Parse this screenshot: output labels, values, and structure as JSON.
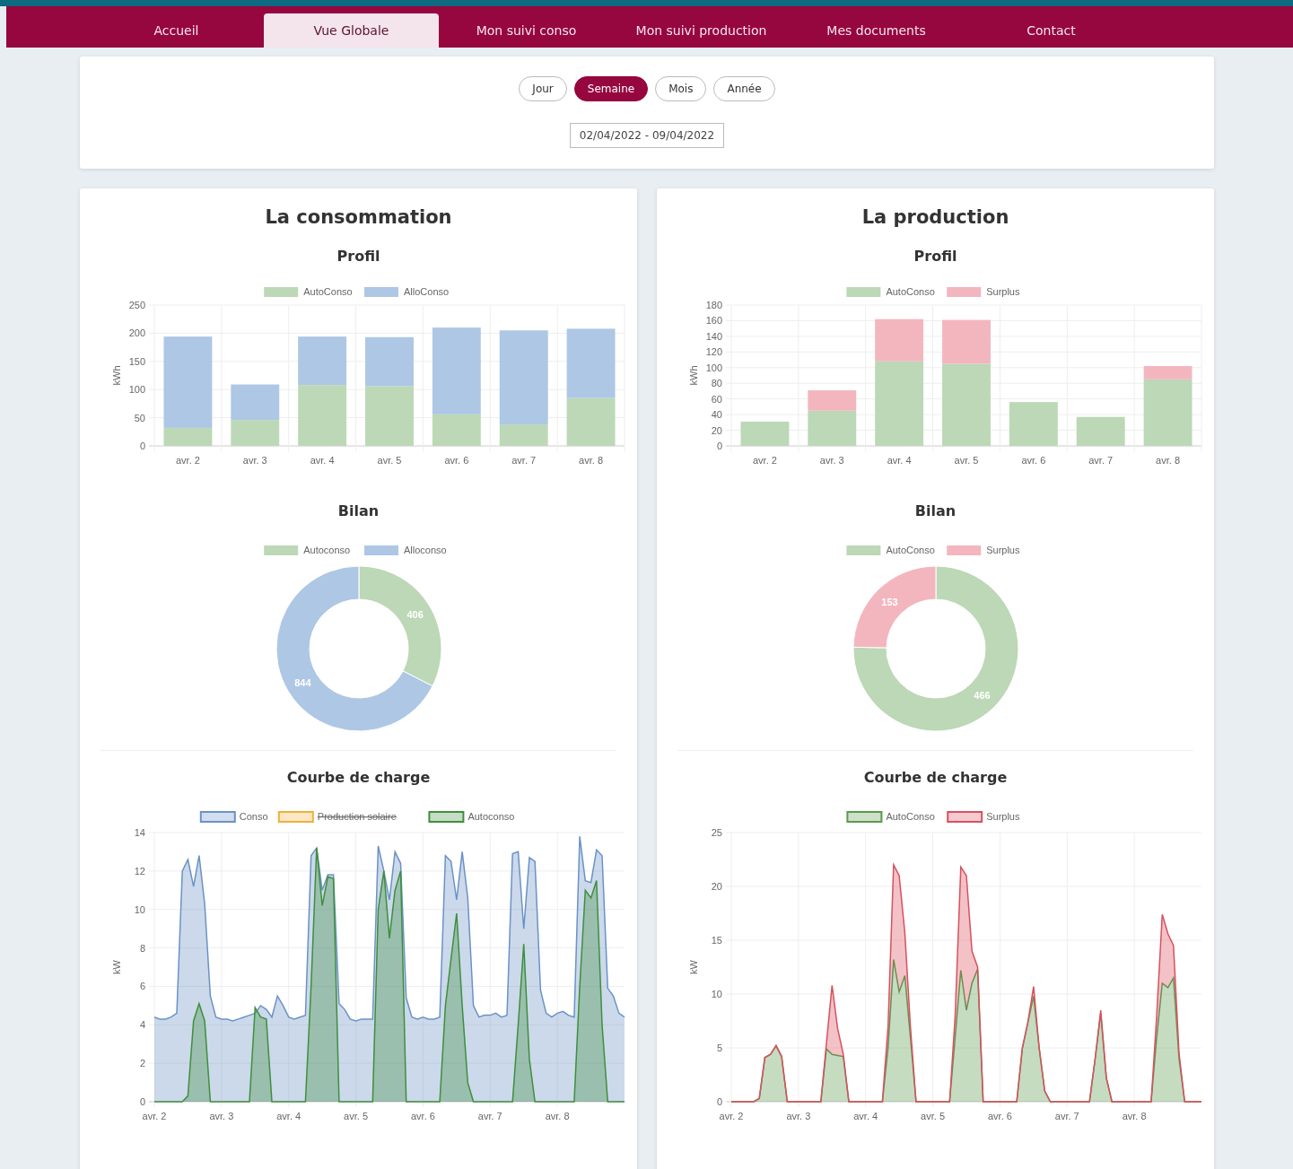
{
  "nav": {
    "tabs": [
      {
        "label": "Accueil",
        "selected": false
      },
      {
        "label": "Vue Globale",
        "selected": true
      },
      {
        "label": "Mon suivi conso",
        "selected": false
      },
      {
        "label": "Mon suivi production",
        "selected": false
      },
      {
        "label": "Mes documents",
        "selected": false
      },
      {
        "label": "Contact",
        "selected": false
      }
    ]
  },
  "filters": {
    "periods": [
      {
        "label": "Jour",
        "selected": false
      },
      {
        "label": "Semaine",
        "selected": true
      },
      {
        "label": "Mois",
        "selected": false
      },
      {
        "label": "Année",
        "selected": false
      }
    ],
    "date_range": "02/04/2022 - 09/04/2022"
  },
  "panels": [
    {
      "title": "La consommation",
      "sections": [
        {
          "title": "Profil",
          "chart_data": {
            "type": "bar",
            "stacked": true,
            "grid": true,
            "ylabel": "kWh",
            "categories": [
              "avr. 2",
              "avr. 3",
              "avr. 4",
              "avr. 5",
              "avr. 6",
              "avr. 7",
              "avr. 8"
            ],
            "legend": true,
            "ylim": [
              0,
              250
            ],
            "yticks": [
              0,
              50,
              100,
              150,
              200,
              250
            ],
            "series": [
              {
                "name": "AutoConso",
                "color": "#bcd8b6",
                "values": [
                  32,
                  46,
                  108,
                  106,
                  56,
                  38,
                  85
                ]
              },
              {
                "name": "AlloConso",
                "color": "#adc7e4",
                "values": [
                  162,
                  63,
                  86,
                  87,
                  154,
                  167,
                  123
                ]
              }
            ]
          }
        },
        {
          "title": "Bilan",
          "chart_data": {
            "type": "donut",
            "data_labels": true,
            "legend": true,
            "categories": [
              "Autoconso",
              "Alloconso"
            ],
            "colors": [
              "#bcd8b6",
              "#adc7e4"
            ],
            "values": [
              406,
              844
            ]
          }
        },
        {
          "title": "Courbe de charge",
          "chart_data": {
            "type": "area",
            "stacked": false,
            "grid": true,
            "legend": {
              "struck": [
                false,
                true,
                false
              ]
            },
            "ylabel": "kW",
            "ylim": [
              0,
              14
            ],
            "yticks": [
              0,
              2,
              4,
              6,
              8,
              10,
              12,
              14
            ],
            "categories": [
              "avr. 2",
              null,
              null,
              null,
              null,
              null,
              null,
              null,
              null,
              null,
              null,
              null,
              "avr. 3",
              null,
              null,
              null,
              null,
              null,
              null,
              null,
              null,
              null,
              null,
              null,
              "avr. 4",
              null,
              null,
              null,
              null,
              null,
              null,
              null,
              null,
              null,
              null,
              null,
              "avr. 5",
              null,
              null,
              null,
              null,
              null,
              null,
              null,
              null,
              null,
              null,
              null,
              "avr. 6",
              null,
              null,
              null,
              null,
              null,
              null,
              null,
              null,
              null,
              null,
              null,
              "avr. 7",
              null,
              null,
              null,
              null,
              null,
              null,
              null,
              null,
              null,
              null,
              null,
              "avr. 8",
              null,
              null,
              null,
              null,
              null,
              null,
              null,
              null,
              null,
              null,
              null,
              null
            ],
            "series": [
              {
                "name": "Conso",
                "color": "#6b92c6",
                "values": [
                  4.4,
                  4.3,
                  4.3,
                  4.4,
                  4.6,
                  12,
                  12.6,
                  11.2,
                  12.8,
                  10.3,
                  5.5,
                  4.4,
                  4.3,
                  4.3,
                  4.2,
                  4.3,
                  4.4,
                  4.5,
                  4.6,
                  5.0,
                  4.8,
                  4.4,
                  5.5,
                  5.0,
                  4.4,
                  4.3,
                  4.4,
                  4.5,
                  12.8,
                  13.2,
                  11,
                  11.8,
                  11.8,
                  5.1,
                  4.8,
                  4.3,
                  4.2,
                  4.3,
                  4.3,
                  4.3,
                  13.3,
                  12.0,
                  10.5,
                  13.0,
                  12.4,
                  5.4,
                  4.4,
                  4.3,
                  4.4,
                  4.3,
                  4.3,
                  4.4,
                  12.8,
                  12.5,
                  10.5,
                  13.0,
                  10.6,
                  5.0,
                  4.4,
                  4.5,
                  4.5,
                  4.6,
                  4.4,
                  4.5,
                  12.9,
                  13,
                  9,
                  12.7,
                  12.5,
                  5.8,
                  4.6,
                  4.4,
                  4.6,
                  4.7,
                  4.5,
                  4.4,
                  13.8,
                  11.5,
                  11.4,
                  13.1,
                  12.8,
                  5.9,
                  5.5,
                  4.6,
                  4.4
                ]
              },
              {
                "name": "Production solaire",
                "color": "#f0b03a",
                "values": [
                  null,
                  null,
                  null,
                  null,
                  null,
                  null,
                  null,
                  null,
                  null,
                  null,
                  null,
                  null,
                  null,
                  null,
                  null,
                  null,
                  null,
                  null,
                  null,
                  null,
                  null,
                  null,
                  null,
                  null,
                  null,
                  null,
                  null,
                  null,
                  null,
                  null,
                  null,
                  null,
                  null,
                  null,
                  null,
                  null,
                  null,
                  null,
                  null,
                  null,
                  null,
                  null,
                  null,
                  null,
                  null,
                  null,
                  null,
                  null,
                  null,
                  null,
                  null,
                  null,
                  null,
                  null,
                  null,
                  null,
                  null,
                  null,
                  null,
                  null,
                  null,
                  null,
                  null,
                  null,
                  null,
                  null,
                  null,
                  null,
                  null,
                  null,
                  null,
                  null,
                  null,
                  null,
                  null,
                  null,
                  null,
                  null,
                  null,
                  null,
                  null,
                  null,
                  null,
                  null,
                  null
                ]
              },
              {
                "name": "Autoconso",
                "color": "#3f8f3c",
                "values": [
                  0,
                  0,
                  0,
                  0,
                  0,
                  0,
                  0.3,
                  4.2,
                  5.1,
                  4.2,
                  0,
                  0,
                  0,
                  0,
                  0,
                  0,
                  0,
                  0,
                  4.9,
                  4.4,
                  4.3,
                  0,
                  0,
                  0,
                  0,
                  0,
                  0,
                  0,
                  6,
                  13.2,
                  10.2,
                  11.7,
                  11.6,
                  0,
                  0,
                  0,
                  0,
                  0,
                  0,
                  0,
                  10,
                  12,
                  8.5,
                  11,
                  12,
                  0,
                  0,
                  0,
                  0,
                  0,
                  0,
                  0,
                  5,
                  7.4,
                  9.8,
                  5,
                  1,
                  0,
                  0,
                  0,
                  0,
                  0,
                  0,
                  0,
                  0,
                  4,
                  8.2,
                  2.2,
                  0,
                  0,
                  0,
                  0,
                  0,
                  0,
                  0,
                  0,
                  6,
                  11,
                  10.6,
                  11.5,
                  4,
                  0,
                  0,
                  0,
                  0
                ]
              }
            ]
          }
        }
      ]
    },
    {
      "title": "La production",
      "sections": [
        {
          "title": "Profil",
          "chart_data": {
            "type": "bar",
            "stacked": true,
            "grid": true,
            "ylabel": "kWh",
            "categories": [
              "avr. 2",
              "avr. 3",
              "avr. 4",
              "avr. 5",
              "avr. 6",
              "avr. 7",
              "avr. 8"
            ],
            "legend": true,
            "ylim": [
              0,
              180
            ],
            "yticks": [
              0,
              20,
              40,
              60,
              80,
              100,
              120,
              140,
              160,
              180
            ],
            "series": [
              {
                "name": "AutoConso",
                "color": "#bcd8b6",
                "values": [
                  31,
                  45,
                  108,
                  105,
                  56,
                  37,
                  85
                ]
              },
              {
                "name": "Surplus",
                "color": "#f3b6bf",
                "values": [
                  0,
                  26,
                  54,
                  56,
                  0,
                  0,
                  17
                ]
              }
            ]
          }
        },
        {
          "title": "Bilan",
          "chart_data": {
            "type": "donut",
            "data_labels": true,
            "legend": true,
            "categories": [
              "AutoConso",
              "Surplus"
            ],
            "colors": [
              "#bcd8b6",
              "#f3b6bf"
            ],
            "values": [
              466,
              153
            ]
          }
        },
        {
          "title": "Courbe de charge",
          "chart_data": {
            "type": "area",
            "stacked": true,
            "grid": true,
            "legend": true,
            "ylabel": "kW",
            "ylim": [
              0,
              25
            ],
            "yticks": [
              0,
              5,
              10,
              15,
              20,
              25
            ],
            "categories": [
              "avr. 2",
              null,
              null,
              null,
              null,
              null,
              null,
              null,
              null,
              null,
              null,
              null,
              "avr. 3",
              null,
              null,
              null,
              null,
              null,
              null,
              null,
              null,
              null,
              null,
              null,
              "avr. 4",
              null,
              null,
              null,
              null,
              null,
              null,
              null,
              null,
              null,
              null,
              null,
              "avr. 5",
              null,
              null,
              null,
              null,
              null,
              null,
              null,
              null,
              null,
              null,
              null,
              "avr. 6",
              null,
              null,
              null,
              null,
              null,
              null,
              null,
              null,
              null,
              null,
              null,
              "avr. 7",
              null,
              null,
              null,
              null,
              null,
              null,
              null,
              null,
              null,
              null,
              null,
              "avr. 8",
              null,
              null,
              null,
              null,
              null,
              null,
              null,
              null,
              null,
              null,
              null,
              null
            ],
            "series": [
              {
                "name": "AutoConso",
                "color": "#5a9a4c",
                "values": [
                  0,
                  0,
                  0,
                  0,
                  0,
                  0.3,
                  4.1,
                  4.4,
                  5.2,
                  4.2,
                  0,
                  0,
                  0,
                  0,
                  0,
                  0,
                  0,
                  4.9,
                  4.4,
                  4.3,
                  4.2,
                  0,
                  0,
                  0,
                  0,
                  0,
                  0,
                  0,
                  5,
                  13.2,
                  10.2,
                  11.7,
                  6,
                  0,
                  0,
                  0,
                  0,
                  0,
                  0,
                  0,
                  6,
                  12.2,
                  8.5,
                  11,
                  12.3,
                  0,
                  0,
                  0,
                  0,
                  0,
                  0,
                  0,
                  5,
                  7.4,
                  9.8,
                  5,
                  1,
                  0,
                  0,
                  0,
                  0,
                  0,
                  0,
                  0,
                  0,
                  4,
                  8.2,
                  2.2,
                  0,
                  0,
                  0,
                  0,
                  0,
                  0,
                  0,
                  0,
                  6,
                  11,
                  10.6,
                  11.5,
                  4,
                  0,
                  0,
                  0,
                  0
                ]
              },
              {
                "name": "Surplus",
                "color": "#d9505f",
                "values": [
                  0,
                  0,
                  0,
                  0,
                  0,
                  0,
                  0,
                  0,
                  0,
                  0,
                  0,
                  0,
                  0,
                  0,
                  0,
                  0,
                  0,
                  0.5,
                  6.4,
                  2.5,
                  0.2,
                  0,
                  0,
                  0,
                  0,
                  0,
                  0,
                  0,
                  2,
                  8.8,
                  10.8,
                  4,
                  1,
                  0,
                  0,
                  0,
                  0,
                  0,
                  0,
                  0,
                  2,
                  9.6,
                  12.5,
                  3,
                  0.2,
                  0,
                  0,
                  0,
                  0,
                  0,
                  0,
                  0,
                  0,
                  0,
                  0.9,
                  0,
                  0,
                  0,
                  0,
                  0,
                  0,
                  0,
                  0,
                  0,
                  0,
                  0,
                  0.3,
                  0,
                  0,
                  0,
                  0,
                  0,
                  0,
                  0,
                  0,
                  0,
                  2,
                  6.4,
                  5,
                  3,
                  0.5,
                  0,
                  0,
                  0,
                  0
                ]
              }
            ]
          }
        }
      ]
    }
  ]
}
